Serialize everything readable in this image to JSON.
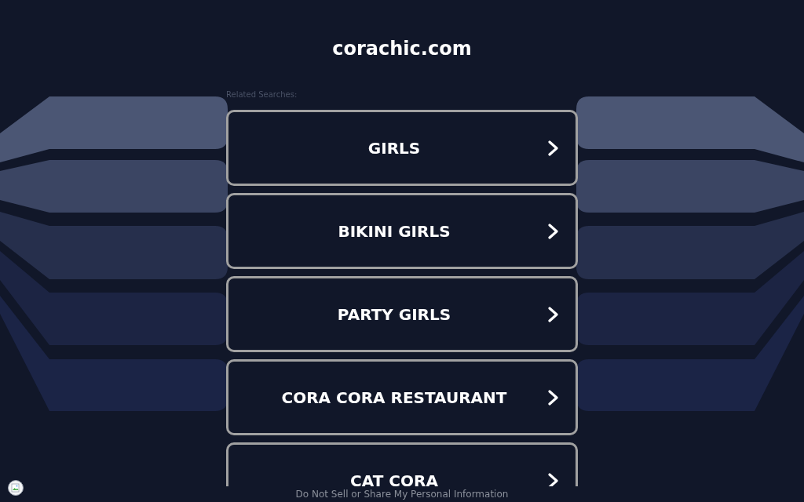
{
  "site_title": "corachic.com",
  "related_searches": {
    "label": "Related Searches:",
    "items": [
      "GIRLS",
      "BIKINI GIRLS",
      "PARTY GIRLS",
      "CORA CORA RESTAURANT",
      "CAT CORA"
    ]
  },
  "footer": {
    "privacy_link": "Do Not Sell or Share My Personal Information"
  }
}
